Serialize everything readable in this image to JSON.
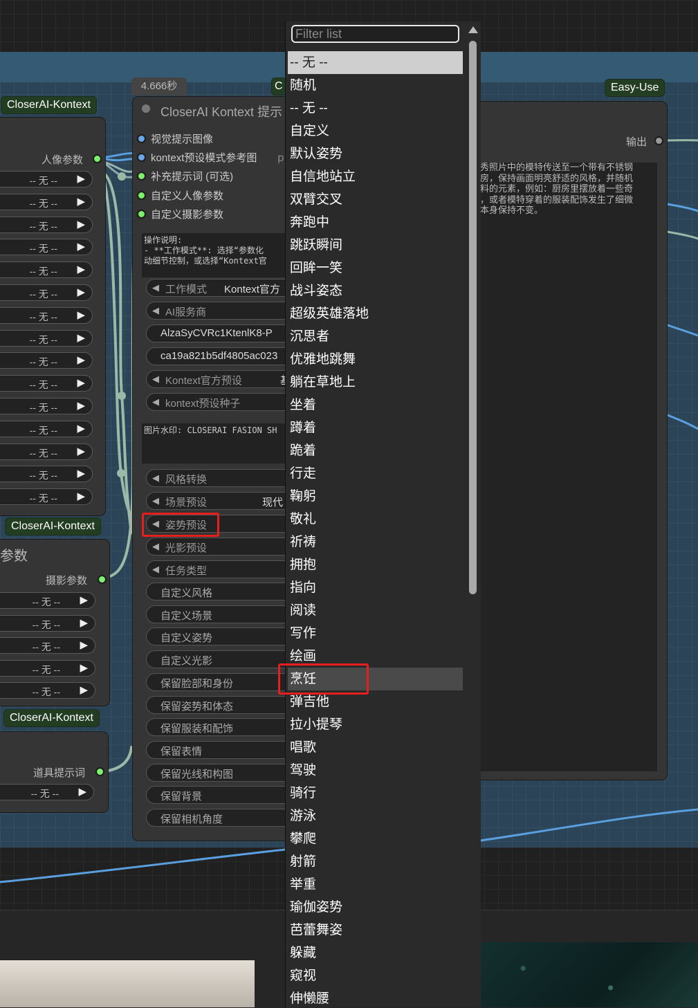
{
  "canvas": {
    "timing": "4.666秒",
    "group_tag_right": "Easy-Use"
  },
  "left_nodes": [
    {
      "title": "CloserAI-Kontext",
      "output_label": "人像参数",
      "values": [
        "-- 无 --",
        "-- 无 --",
        "-- 无 --",
        "-- 无 --",
        "-- 无 --",
        "-- 无 --",
        "-- 无 --",
        "-- 无 --",
        "-- 无 --",
        "-- 无 --",
        "-- 无 --",
        "-- 无 --",
        "-- 无 --",
        "-- 无 --",
        "-- 无 --"
      ]
    },
    {
      "title": "CloserAI-Kontext",
      "header_fragment": "参数",
      "output_label": "摄影参数",
      "values": [
        "-- 无 --",
        "-- 无 --",
        "-- 无 --",
        "-- 无 --",
        "-- 无 --"
      ]
    },
    {
      "title": "CloserAI-Kontext",
      "output_label": "道具提示词",
      "values": [
        "-- 无 --"
      ]
    }
  ],
  "main_node": {
    "title": "CloserAI Kontext 提示",
    "inputs": [
      "视觉提示图像",
      "kontext预设模式参考图",
      "补充提示词 (可选)",
      "自定义人像参数",
      "自定义摄影参数"
    ],
    "input_suffix": "p",
    "instructions": "操作说明:\n- **工作模式**: 选择“参数化\n动细节控制，或选择“Kontext官",
    "widgets": [
      {
        "label": "工作模式",
        "value": "Kontext官方"
      },
      {
        "label": "AI服务商",
        "value": ""
      },
      {
        "label": "AlzaSyCVRc1KtenlK8-P",
        "value": ""
      },
      {
        "label": "ca19a821b5df4805ac023",
        "value": ""
      },
      {
        "label": "Kontext官方预设",
        "value": "基"
      },
      {
        "label": "kontext预设种子",
        "value": ""
      }
    ],
    "watermark_text": "图片水印: CLOSERAI FASION SH",
    "widgets2": [
      {
        "label": "风格转换",
        "value": ""
      },
      {
        "label": "场景预设",
        "value": "现代"
      },
      {
        "label": "姿势预设",
        "value": ""
      },
      {
        "label": "光影预设",
        "value": ""
      },
      {
        "label": "任务类型",
        "value": ""
      }
    ],
    "custom_fields": [
      "自定义风格",
      "自定义场景",
      "自定义姿势",
      "自定义光影",
      "保留脸部和身份",
      "保留姿势和体态",
      "保留服装和配饰",
      "保留表情",
      "保留光线和构图",
      "保留背景",
      "保留相机角度"
    ]
  },
  "right_node": {
    "output_label": "输出",
    "text": "秀照片中的模特传送至一个带有不锈钢\n房，保持画面明亮舒适的风格，并随机\n料的元素，例如：厨房里摆放着一些奇\n，或者模特穿着的服装配饰发生了细微\n本身保持不变。",
    "partial_tag": "C"
  },
  "dropdown": {
    "placeholder": "Filter list",
    "selected_index": 0,
    "hover_index": 27,
    "items": [
      "-- 无 --",
      "随机",
      "-- 无 --",
      "自定义",
      "默认姿势",
      "自信地站立",
      "双臂交叉",
      "奔跑中",
      "跳跃瞬间",
      "回眸一笑",
      "战斗姿态",
      "超级英雄落地",
      "沉思者",
      "优雅地跳舞",
      "躺在草地上",
      "坐着",
      "蹲着",
      "跪着",
      "行走",
      "鞠躬",
      "敬礼",
      "祈祷",
      "拥抱",
      "指向",
      "阅读",
      "写作",
      "绘画",
      "烹饪",
      "弹吉他",
      "拉小提琴",
      "唱歌",
      "驾驶",
      "骑行",
      "游泳",
      "攀爬",
      "射箭",
      "举重",
      "瑜伽姿势",
      "芭蕾舞姿",
      "躲藏",
      "窥视",
      "伸懒腰"
    ]
  },
  "highlights": {
    "annotation_color": "#e81d1d"
  }
}
